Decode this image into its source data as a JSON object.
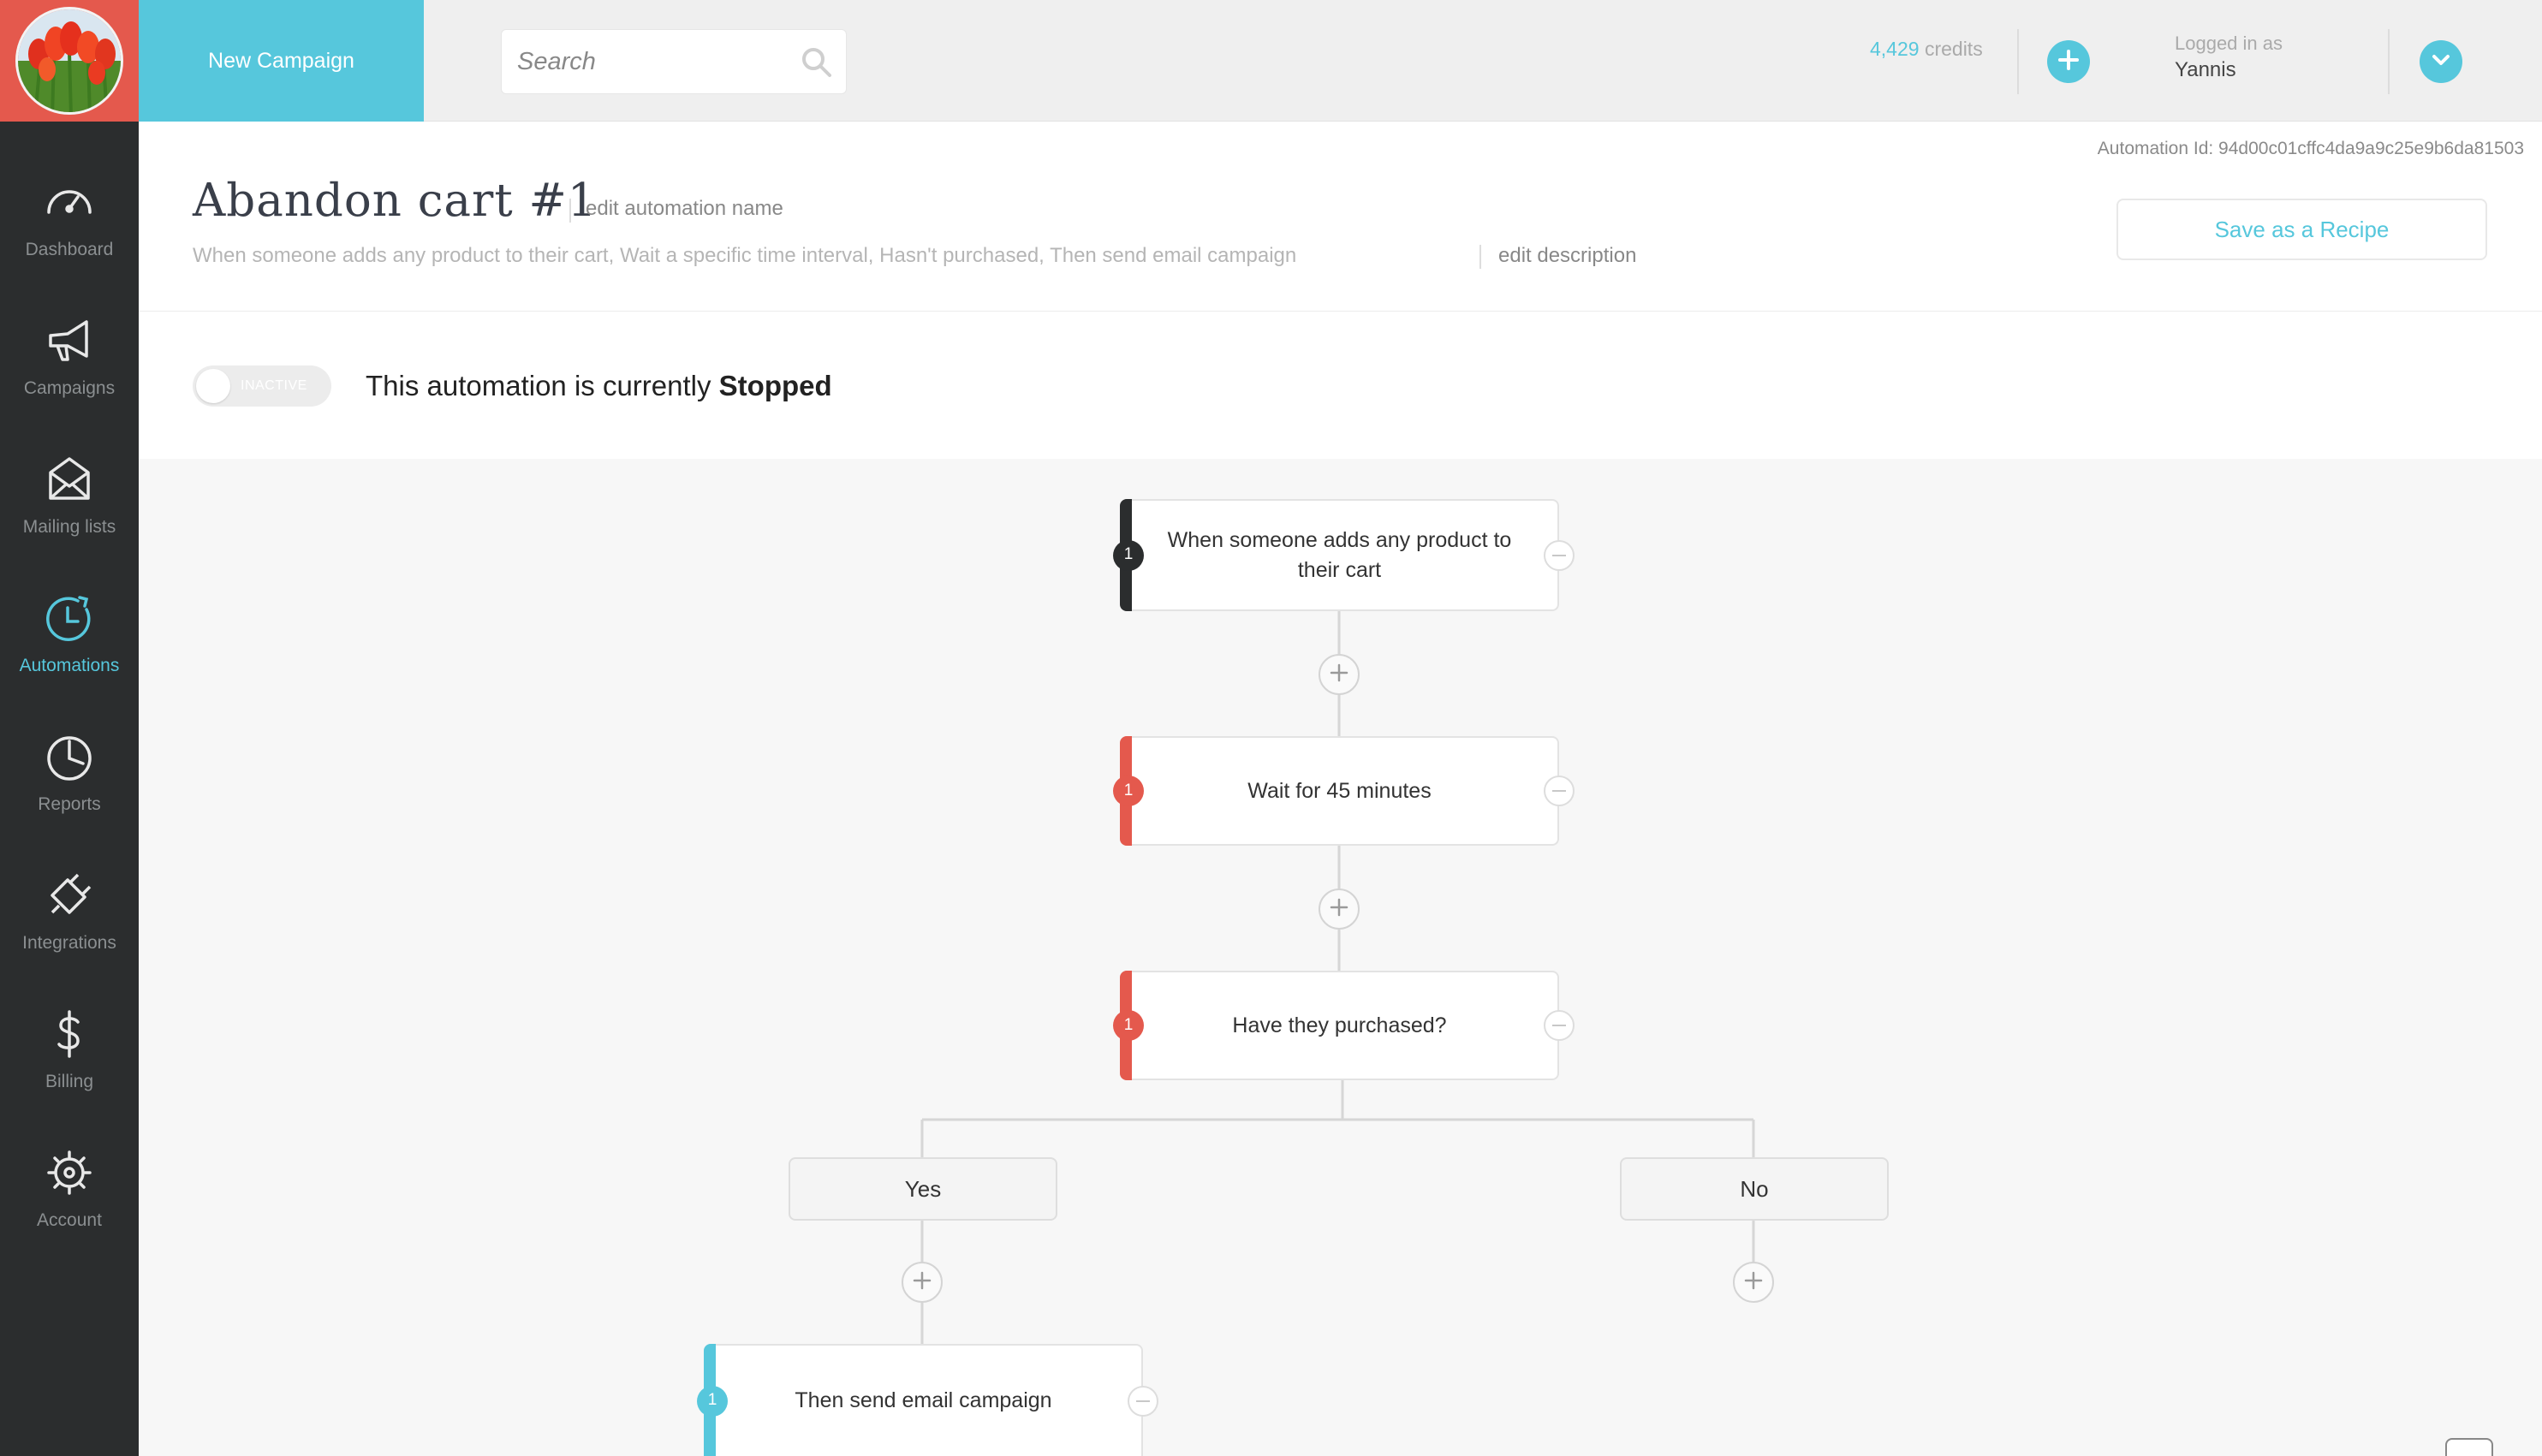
{
  "sidebar": {
    "items": [
      {
        "label": "Dashboard",
        "icon": "gauge-icon"
      },
      {
        "label": "Campaigns",
        "icon": "megaphone-icon"
      },
      {
        "label": "Mailing lists",
        "icon": "envelope-icon"
      },
      {
        "label": "Automations",
        "icon": "clock-icon",
        "active": true
      },
      {
        "label": "Reports",
        "icon": "pie-chart-icon"
      },
      {
        "label": "Integrations",
        "icon": "plug-icon"
      },
      {
        "label": "Billing",
        "icon": "dollar-icon"
      },
      {
        "label": "Account",
        "icon": "gear-icon"
      }
    ]
  },
  "topbar": {
    "new_campaign_label": "New Campaign",
    "search_placeholder": "Search",
    "credits_count": "4,429",
    "credits_unit": "credits",
    "logged_in_label": "Logged in as",
    "username": "Yannis"
  },
  "header": {
    "automation_id": "Automation Id: 94d00c01cffc4da9a9c25e9b6da81503",
    "title": "Abandon cart #1",
    "edit_name_label": "edit automation name",
    "description": "When someone adds any product to their cart, Wait a specific time interval, Hasn't purchased, Then send email campaign",
    "edit_description_label": "edit description",
    "save_recipe_label": "Save as a Recipe"
  },
  "status": {
    "toggle_label": "INACTIVE",
    "text_prefix": "This automation is currently",
    "state": "Stopped"
  },
  "flow": {
    "steps": [
      {
        "badge": "1",
        "text": "When someone adds any product to their cart",
        "color": "#2b2d2e"
      },
      {
        "badge": "1",
        "text": "Wait for 45 minutes",
        "color": "#e4594d"
      },
      {
        "badge": "1",
        "text": "Have they purchased?",
        "color": "#e4594d"
      }
    ],
    "branches": {
      "yes": "Yes",
      "no": "No"
    },
    "yes_step": {
      "badge": "1",
      "text": "Then send email campaign",
      "color": "#56c7dc"
    }
  },
  "colors": {
    "accent": "#56c7dc",
    "brand_red": "#e4594d",
    "sidebar_bg": "#2b2d2e"
  }
}
